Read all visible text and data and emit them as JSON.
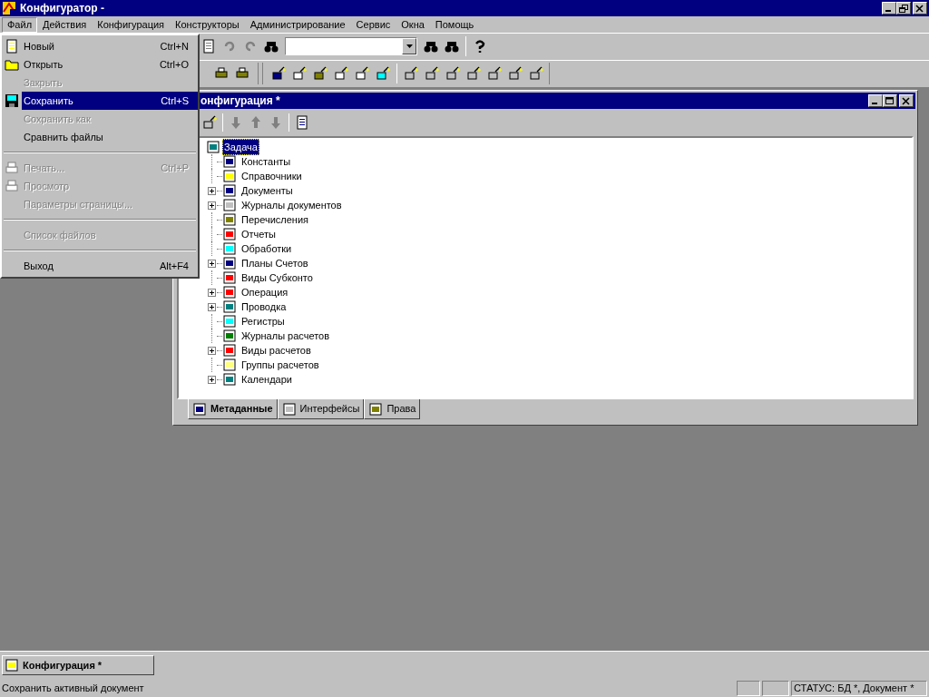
{
  "window": {
    "title": "Конфигуратор -"
  },
  "menubar": [
    {
      "label": "Файл",
      "selected": true
    },
    {
      "label": "Действия",
      "selected": false
    },
    {
      "label": "Конфигурация",
      "selected": false
    },
    {
      "label": "Конструкторы",
      "selected": false
    },
    {
      "label": "Администрирование",
      "selected": false
    },
    {
      "label": "Сервис",
      "selected": false
    },
    {
      "label": "Окна",
      "selected": false
    },
    {
      "label": "Помощь",
      "selected": false
    }
  ],
  "file_menu": [
    {
      "kind": "item",
      "label": "Новый",
      "shortcut": "Ctrl+N",
      "disabled": false,
      "selected": false
    },
    {
      "kind": "item",
      "label": "Открыть",
      "shortcut": "Ctrl+O",
      "disabled": false,
      "selected": false
    },
    {
      "kind": "item",
      "label": "Закрыть",
      "disabled": true,
      "selected": false
    },
    {
      "kind": "item",
      "label": "Сохранить",
      "shortcut": "Ctrl+S",
      "disabled": false,
      "selected": true
    },
    {
      "kind": "item",
      "label": "Сохранить как",
      "disabled": true,
      "selected": false
    },
    {
      "kind": "item",
      "label": "Сравнить файлы",
      "disabled": false,
      "selected": false
    },
    {
      "kind": "separator"
    },
    {
      "kind": "item",
      "label": "Печать...",
      "shortcut": "Ctrl+P",
      "disabled": true,
      "selected": false
    },
    {
      "kind": "item",
      "label": "Просмотр",
      "disabled": true,
      "selected": false
    },
    {
      "kind": "item",
      "label": "Параметры страницы...",
      "disabled": true,
      "selected": false
    },
    {
      "kind": "separator"
    },
    {
      "kind": "item",
      "label": "Список файлов",
      "disabled": true,
      "selected": false
    },
    {
      "kind": "separator"
    },
    {
      "kind": "item",
      "label": "Выход",
      "shortcut": "Alt+F4",
      "disabled": false,
      "selected": false
    }
  ],
  "child_window": {
    "title": "онфигурация *",
    "tree": {
      "label": "Задача",
      "selected": true,
      "children": [
        {
          "label": "Константы",
          "expandable": false,
          "selected": false
        },
        {
          "label": "Справочники",
          "expandable": false,
          "selected": false
        },
        {
          "label": "Документы",
          "expandable": true,
          "selected": false
        },
        {
          "label": "Журналы документов",
          "expandable": true,
          "selected": false
        },
        {
          "label": "Перечисления",
          "expandable": false,
          "selected": false
        },
        {
          "label": "Отчеты",
          "expandable": false,
          "selected": false
        },
        {
          "label": "Обработки",
          "expandable": false,
          "selected": false
        },
        {
          "label": "Планы Счетов",
          "expandable": true,
          "selected": false
        },
        {
          "label": "Виды Субконто",
          "expandable": false,
          "selected": false
        },
        {
          "label": "Операция",
          "expandable": true,
          "selected": false
        },
        {
          "label": "Проводка",
          "expandable": true,
          "selected": false
        },
        {
          "label": "Регистры",
          "expandable": false,
          "selected": false
        },
        {
          "label": "Журналы расчетов",
          "expandable": false,
          "selected": false
        },
        {
          "label": "Виды расчетов",
          "expandable": true,
          "selected": false
        },
        {
          "label": "Группы расчетов",
          "expandable": false,
          "selected": false
        },
        {
          "label": "Календари",
          "expandable": true,
          "selected": false
        }
      ]
    },
    "tabs": [
      {
        "label": "Метаданные",
        "selected": true
      },
      {
        "label": "Интерфейсы",
        "selected": false
      },
      {
        "label": "Права",
        "selected": false
      }
    ]
  },
  "taskbar": [
    {
      "label": "Конфигурация *",
      "selected": false
    }
  ],
  "status_bar": {
    "message": "Сохранить активный документ",
    "status": "СТАТУС: БД *, Документ *"
  }
}
